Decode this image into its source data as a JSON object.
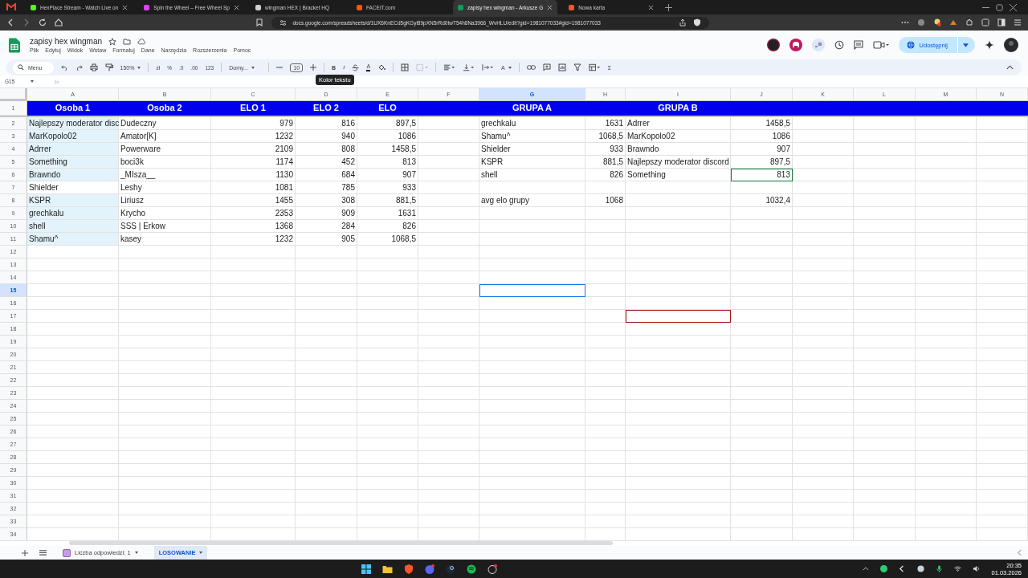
{
  "browser": {
    "tabs": [
      {
        "title": "HexPlace Stream - Watch Live on",
        "selected": false,
        "color": "#53fc18"
      },
      {
        "title": "Spin the Wheel – Free Wheel Sp",
        "selected": false,
        "color": "#e040fb"
      },
      {
        "title": "wingman HEX | Bracket HQ",
        "selected": false,
        "color": "#d0d0d0"
      },
      {
        "title": "FACEIT.com",
        "selected": false,
        "color": "#ff5500"
      },
      {
        "title": "zapisy hex wingman - Arkusze G",
        "selected": true,
        "color": "#0f9d58"
      },
      {
        "title": "Nowa karta",
        "selected": false,
        "color": "#fb542b"
      }
    ],
    "url": "docs.google.com/spreadsheets/d/1UX6KnECd5gKGyi89pXN5rRd0twT54h8Na3966_WvHLU/edit?gid=1981077033#gid=1981077033"
  },
  "document": {
    "title": "zapisy hex wingman",
    "menus": [
      "Plik",
      "Edytuj",
      "Widok",
      "Wstaw",
      "Formatuj",
      "Dane",
      "Narzędzia",
      "Rozszerzenia",
      "Pomoc"
    ],
    "share": "Udostępnij"
  },
  "toolbar": {
    "search": "Menu",
    "zoom": "150%",
    "currency": "zł",
    "percent": "%",
    "decrease_decimals": ".0",
    "increase_decimals": ".00",
    "number_format": "123",
    "font": "Domy...",
    "font_size": "10",
    "bold": "B",
    "italic": "I",
    "text_color": "A",
    "rotate": "A",
    "functions": "Σ",
    "tooltip": "Kolor tekstu"
  },
  "formula_bar": {
    "name_box": "G15",
    "fx": "fx"
  },
  "sheet": {
    "columns": [
      {
        "letter": "A",
        "kind": "text",
        "selected": false
      },
      {
        "letter": "B",
        "kind": "text",
        "selected": false
      },
      {
        "letter": "C",
        "kind": "number",
        "selected": false
      },
      {
        "letter": "D",
        "kind": "number",
        "selected": false
      },
      {
        "letter": "E",
        "kind": "number",
        "selected": false
      },
      {
        "letter": "F",
        "kind": "text",
        "selected": false
      },
      {
        "letter": "G",
        "kind": "text",
        "selected": true
      },
      {
        "letter": "H",
        "kind": "number",
        "selected": false
      },
      {
        "letter": "I",
        "kind": "text",
        "selected": false
      },
      {
        "letter": "J",
        "kind": "number",
        "selected": false
      },
      {
        "letter": "K",
        "kind": "text",
        "selected": false
      },
      {
        "letter": "L",
        "kind": "text",
        "selected": false
      },
      {
        "letter": "M",
        "kind": "text",
        "selected": false
      },
      {
        "letter": "N",
        "kind": "text",
        "selected": false
      }
    ],
    "rows": [
      {
        "number": "1",
        "kind": "header",
        "selected": false,
        "cells": [
          {
            "text": "Osoba 1",
            "highlighted": false
          },
          {
            "text": "Osoba 2",
            "highlighted": false
          },
          {
            "text": "ELO 1",
            "highlighted": false
          },
          {
            "text": "ELO 2",
            "highlighted": false
          },
          {
            "text": "ELO",
            "highlighted": false
          },
          null,
          {
            "text": "GRUPA A",
            "highlighted": false
          },
          null,
          {
            "text": "GRUPA B",
            "highlighted": false
          }
        ]
      },
      {
        "number": "2",
        "kind": "data",
        "selected": false,
        "cells": [
          {
            "text": "Najlepszy moderator disc",
            "highlighted": true
          },
          {
            "text": "Dudeczny",
            "highlighted": false
          },
          {
            "text": "979",
            "highlighted": false
          },
          {
            "text": "816",
            "highlighted": false
          },
          {
            "text": "897,5",
            "highlighted": false
          },
          null,
          {
            "text": "grechkalu",
            "highlighted": false
          },
          {
            "text": "1631",
            "highlighted": false
          },
          {
            "text": "Adrrer",
            "highlighted": false
          },
          {
            "text": "1458,5",
            "highlighted": false
          }
        ]
      },
      {
        "number": "3",
        "kind": "data",
        "selected": false,
        "cells": [
          {
            "text": "MarKopolo02",
            "highlighted": true
          },
          {
            "text": "Amator[K]",
            "highlighted": false
          },
          {
            "text": "1232",
            "highlighted": false
          },
          {
            "text": "940",
            "highlighted": false
          },
          {
            "text": "1086",
            "highlighted": false
          },
          null,
          {
            "text": "Shamu^",
            "highlighted": false
          },
          {
            "text": "1068,5",
            "highlighted": false
          },
          {
            "text": "MarKopolo02",
            "highlighted": false
          },
          {
            "text": "1086",
            "highlighted": false
          }
        ]
      },
      {
        "number": "4",
        "kind": "data",
        "selected": false,
        "cells": [
          {
            "text": "Adrrer",
            "highlighted": true
          },
          {
            "text": "Powerware",
            "highlighted": false
          },
          {
            "text": "2109",
            "highlighted": false
          },
          {
            "text": "808",
            "highlighted": false
          },
          {
            "text": "1458,5",
            "highlighted": false
          },
          null,
          {
            "text": "Shielder",
            "highlighted": false
          },
          {
            "text": "933",
            "highlighted": false
          },
          {
            "text": "Brawndo",
            "highlighted": false
          },
          {
            "text": "907",
            "highlighted": false
          }
        ]
      },
      {
        "number": "5",
        "kind": "data",
        "selected": false,
        "cells": [
          {
            "text": "Something",
            "highlighted": true
          },
          {
            "text": "boci3k",
            "highlighted": false
          },
          {
            "text": "1174",
            "highlighted": false
          },
          {
            "text": "452",
            "highlighted": false
          },
          {
            "text": "813",
            "highlighted": false
          },
          null,
          {
            "text": "KSPR",
            "highlighted": false
          },
          {
            "text": "881,5",
            "highlighted": false
          },
          {
            "text": "Najlepszy moderator discord",
            "highlighted": false
          },
          {
            "text": "897,5",
            "highlighted": false
          }
        ]
      },
      {
        "number": "6",
        "kind": "data",
        "selected": false,
        "cells": [
          {
            "text": "Brawndo",
            "highlighted": true
          },
          {
            "text": "_MIsza__",
            "highlighted": false
          },
          {
            "text": "1130",
            "highlighted": false
          },
          {
            "text": "684",
            "highlighted": false
          },
          {
            "text": "907",
            "highlighted": false
          },
          null,
          {
            "text": "shell",
            "highlighted": false
          },
          {
            "text": "826",
            "highlighted": false
          },
          {
            "text": "Something",
            "highlighted": false
          },
          {
            "text": "813",
            "highlighted": false,
            "color": "#137333"
          }
        ]
      },
      {
        "number": "7",
        "kind": "data",
        "selected": false,
        "cells": [
          {
            "text": "Shielder",
            "highlighted": false
          },
          {
            "text": "Leshy",
            "highlighted": false
          },
          {
            "text": "1081",
            "highlighted": false
          },
          {
            "text": "785",
            "highlighted": false
          },
          {
            "text": "933",
            "highlighted": false
          }
        ]
      },
      {
        "number": "8",
        "kind": "data",
        "selected": false,
        "cells": [
          {
            "text": "KSPR",
            "highlighted": true
          },
          {
            "text": "Liriusz",
            "highlighted": false
          },
          {
            "text": "1455",
            "highlighted": false
          },
          {
            "text": "308",
            "highlighted": false
          },
          {
            "text": "881,5",
            "highlighted": false
          },
          null,
          {
            "text": "avg elo grupy",
            "highlighted": false
          },
          {
            "text": "1068",
            "highlighted": false
          },
          null,
          {
            "text": "1032,4",
            "highlighted": false
          }
        ]
      },
      {
        "number": "9",
        "kind": "data",
        "selected": false,
        "cells": [
          {
            "text": "grechkalu",
            "highlighted": true
          },
          {
            "text": "Krycho",
            "highlighted": false
          },
          {
            "text": "2353",
            "highlighted": false
          },
          {
            "text": "909",
            "highlighted": false
          },
          {
            "text": "1631",
            "highlighted": false
          }
        ]
      },
      {
        "number": "10",
        "kind": "data",
        "selected": false,
        "cells": [
          {
            "text": "shell",
            "highlighted": true
          },
          {
            "text": "SSS | Erkow",
            "highlighted": false
          },
          {
            "text": "1368",
            "highlighted": false
          },
          {
            "text": "284",
            "highlighted": false
          },
          {
            "text": "826",
            "highlighted": false
          }
        ]
      },
      {
        "number": "11",
        "kind": "data",
        "selected": false,
        "cells": [
          {
            "text": "Shamu^",
            "highlighted": true
          },
          {
            "text": "kasey",
            "highlighted": false
          },
          {
            "text": "1232",
            "highlighted": false
          },
          {
            "text": "905",
            "highlighted": false
          },
          {
            "text": "1068,5",
            "highlighted": false
          }
        ]
      },
      {
        "number": "12",
        "kind": "data",
        "selected": false
      },
      {
        "number": "13",
        "kind": "data",
        "selected": false
      },
      {
        "number": "14",
        "kind": "data",
        "selected": false
      },
      {
        "number": "15",
        "kind": "data",
        "selected": true,
        "cells": [
          null,
          null,
          null,
          null,
          null,
          null,
          {
            "highlighted": false,
            "color": "#1a73e8"
          }
        ]
      },
      {
        "number": "16",
        "kind": "data",
        "selected": false
      },
      {
        "number": "17",
        "kind": "data",
        "selected": false,
        "cells": [
          null,
          null,
          null,
          null,
          null,
          null,
          null,
          null,
          {
            "highlighted": false,
            "color": "#a50e0e"
          }
        ]
      },
      {
        "number": "18",
        "kind": "data",
        "selected": false
      },
      {
        "number": "19",
        "kind": "data",
        "selected": false
      },
      {
        "number": "20",
        "kind": "data",
        "selected": false
      },
      {
        "number": "21",
        "kind": "data",
        "selected": false
      },
      {
        "number": "22",
        "kind": "data",
        "selected": false
      },
      {
        "number": "23",
        "kind": "data",
        "selected": false
      },
      {
        "number": "24",
        "kind": "data",
        "selected": false
      },
      {
        "number": "25",
        "kind": "data",
        "selected": false
      },
      {
        "number": "26",
        "kind": "data",
        "selected": false
      },
      {
        "number": "27",
        "kind": "data",
        "selected": false
      },
      {
        "number": "28",
        "kind": "data",
        "selected": false
      },
      {
        "number": "29",
        "kind": "data",
        "selected": false
      },
      {
        "number": "30",
        "kind": "data",
        "selected": false
      },
      {
        "number": "31",
        "kind": "data",
        "selected": false
      },
      {
        "number": "32",
        "kind": "data",
        "selected": false
      },
      {
        "number": "33",
        "kind": "data",
        "selected": false
      },
      {
        "number": "34",
        "kind": "data",
        "selected": false
      }
    ]
  },
  "sheet_tabs": [
    {
      "label": "Liczba odpowiedzi: 1",
      "selected": false
    },
    {
      "label": "LOSOWANIE",
      "selected": true
    }
  ],
  "taskbar": {
    "time": "20:35",
    "date": "01.03.2026"
  }
}
